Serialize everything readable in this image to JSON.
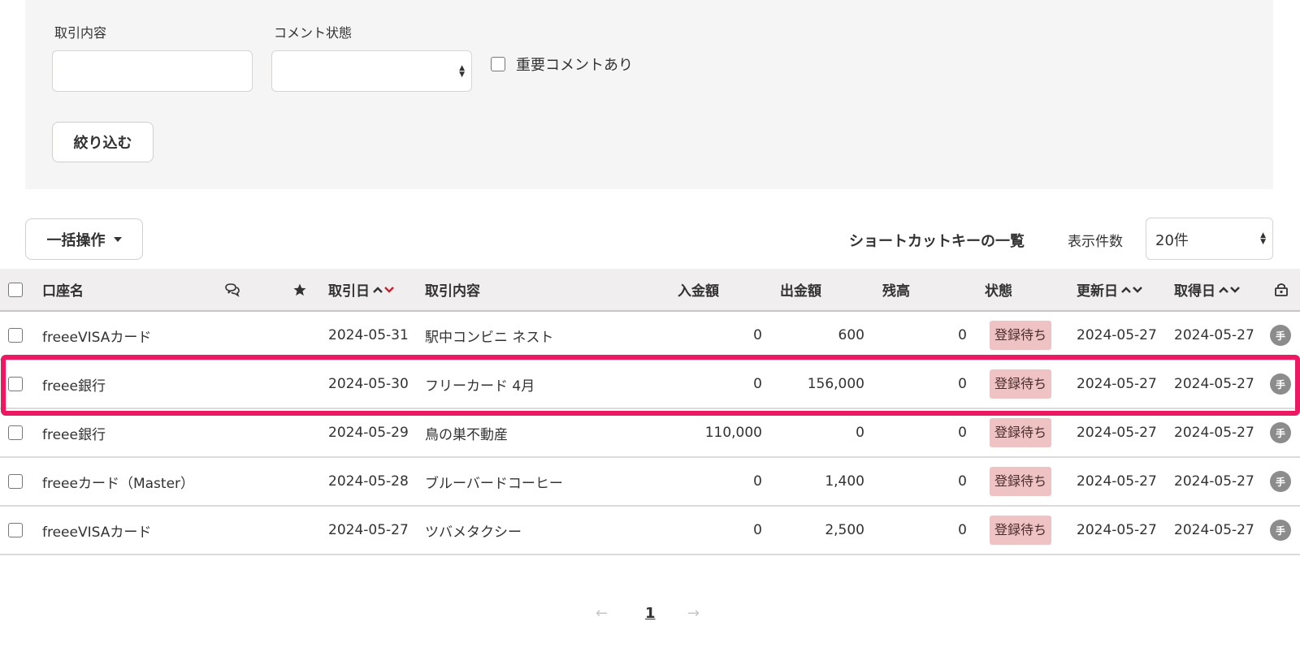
{
  "filters": {
    "transaction_label": "取引内容",
    "transaction_value": "",
    "comment_status_label": "コメント状態",
    "comment_status_value": "",
    "important_comment_label": "重要コメントあり",
    "filter_button": "絞り込む"
  },
  "toolbar": {
    "bulk_action": "一括操作",
    "shortcut_list": "ショートカットキーの一覧",
    "page_size_label": "表示件数",
    "page_size_value": "20件"
  },
  "table": {
    "headers": {
      "account": "口座名",
      "date": "取引日",
      "description": "取引内容",
      "deposit": "入金額",
      "withdrawal": "出金額",
      "balance": "残高",
      "status": "状態",
      "updated": "更新日",
      "acquired": "取得日"
    },
    "rows": [
      {
        "account": "freeeVISAカード",
        "date": "2024-05-31",
        "description": "駅中コンビニ ネスト",
        "deposit": "0",
        "withdrawal": "600",
        "balance": "0",
        "status": "登録待ち",
        "updated": "2024-05-27",
        "acquired": "2024-05-27",
        "hand": "手"
      },
      {
        "account": "freee銀行",
        "date": "2024-05-30",
        "description": "フリーカード 4月",
        "deposit": "0",
        "withdrawal": "156,000",
        "balance": "0",
        "status": "登録待ち",
        "updated": "2024-05-27",
        "acquired": "2024-05-27",
        "hand": "手"
      },
      {
        "account": "freee銀行",
        "date": "2024-05-29",
        "description": "鳥の巣不動産",
        "deposit": "110,000",
        "withdrawal": "0",
        "balance": "0",
        "status": "登録待ち",
        "updated": "2024-05-27",
        "acquired": "2024-05-27",
        "hand": "手"
      },
      {
        "account": "freeeカード（Master）",
        "date": "2024-05-28",
        "description": "ブルーバードコーヒー",
        "deposit": "0",
        "withdrawal": "1,400",
        "balance": "0",
        "status": "登録待ち",
        "updated": "2024-05-27",
        "acquired": "2024-05-27",
        "hand": "手"
      },
      {
        "account": "freeeVISAカード",
        "date": "2024-05-27",
        "description": "ツバメタクシー",
        "deposit": "0",
        "withdrawal": "2,500",
        "balance": "0",
        "status": "登録待ち",
        "updated": "2024-05-27",
        "acquired": "2024-05-27",
        "hand": "手"
      }
    ]
  },
  "pagination": {
    "prev": "←",
    "current": "1",
    "next": "→"
  },
  "colors": {
    "highlight": "#ec1862",
    "status_badge": "#efc3c4",
    "active_sort": "#c4232f"
  }
}
